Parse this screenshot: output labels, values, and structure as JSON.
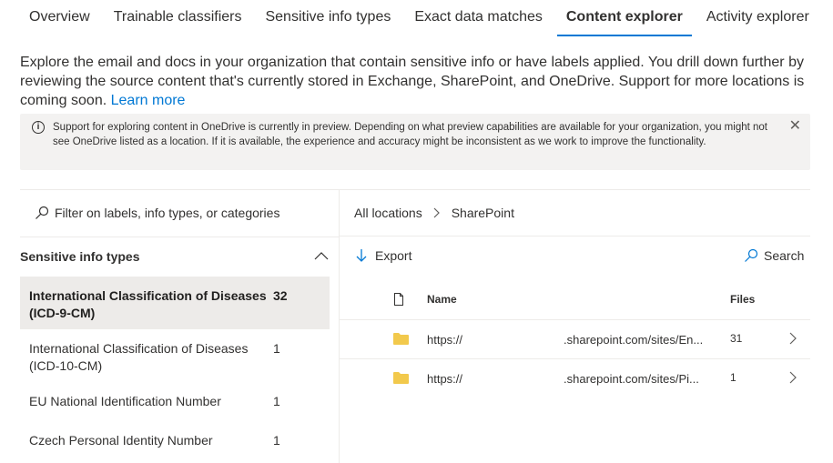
{
  "tabs": [
    {
      "label": "Overview"
    },
    {
      "label": "Trainable classifiers"
    },
    {
      "label": "Sensitive info types"
    },
    {
      "label": "Exact data matches"
    },
    {
      "label": "Content explorer"
    },
    {
      "label": "Activity explorer"
    }
  ],
  "description": {
    "text": "Explore the email and docs in your organization that contain sensitive info or have labels applied. You drill down further by reviewing the source content that's currently stored in Exchange, SharePoint, and OneDrive. Support for more locations is coming soon.",
    "link": "Learn more"
  },
  "banner": {
    "text": "Support for exploring content in OneDrive is currently in preview. Depending on what preview capabilities are available for your organization, you might not see OneDrive listed as a location. If it is available, the experience and accuracy might be inconsistent as we work to improve the functionality."
  },
  "filter": {
    "placeholder": "Filter on labels, info types, or categories"
  },
  "section": {
    "title": "Sensitive info types"
  },
  "items": [
    {
      "label": "International Classification of Diseases (ICD-9-CM)",
      "count": "32"
    },
    {
      "label": "International Classification of Diseases (ICD-10-CM)",
      "count": "1"
    },
    {
      "label": "EU National Identification Number",
      "count": "1"
    },
    {
      "label": "Czech Personal Identity Number",
      "count": "1"
    }
  ],
  "breadcrumb": {
    "root": "All locations",
    "current": "SharePoint"
  },
  "toolbar": {
    "export_label": "Export",
    "search_label": "Search"
  },
  "table": {
    "headers": {
      "name": "Name",
      "files": "Files"
    },
    "rows": [
      {
        "url_start": "https://",
        "url_end": ".sharepoint.com/sites/En...",
        "files": "31"
      },
      {
        "url_start": "https://",
        "url_end": ".sharepoint.com/sites/Pi...",
        "files": "1"
      }
    ]
  },
  "colors": {
    "accent": "#0078d4",
    "banner_bg": "#f3f2f1",
    "selected_bg": "#edebe9",
    "folder": "#f2c94c"
  }
}
